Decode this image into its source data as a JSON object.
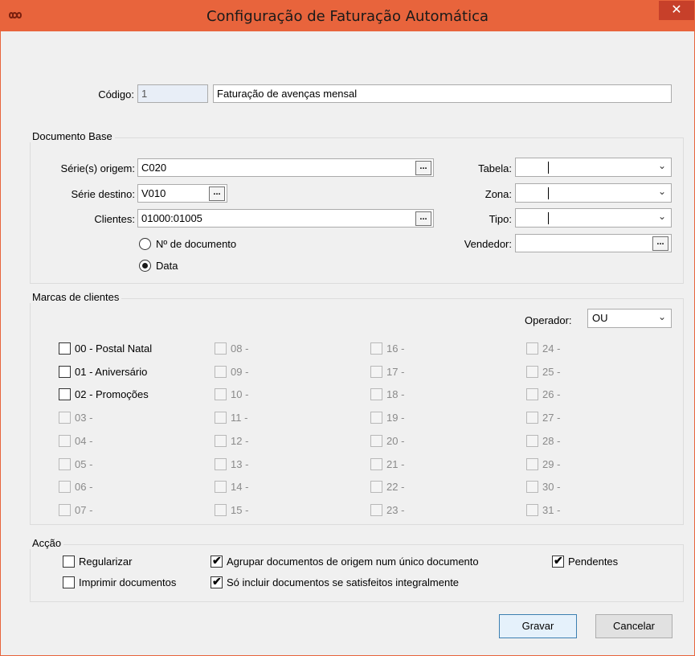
{
  "window": {
    "title": "Configuração de Faturação Automática",
    "close_glyph": "✕",
    "app_icon": "infinity-icon"
  },
  "codigo": {
    "label": "Código:",
    "value": "1",
    "description": "Faturação de avenças mensal"
  },
  "documento_base": {
    "title": "Documento Base",
    "serie_origem_label": "Série(s) origem:",
    "serie_origem_value": "C020",
    "serie_destino_label": "Série destino:",
    "serie_destino_value": "V010",
    "clientes_label": "Clientes:",
    "clientes_value": "01000:01005",
    "ellipsis": "...",
    "radio_num_doc": "Nº de documento",
    "radio_data": "Data",
    "tabela_label": "Tabela:",
    "zona_label": "Zona:",
    "tipo_label": "Tipo:",
    "vendedor_label": "Vendedor:",
    "arrow": "⌄"
  },
  "marcas": {
    "title": "Marcas de clientes",
    "operador_label": "Operador:",
    "operador_value": "OU",
    "columns": [
      [
        "00 - Postal Natal",
        "01 - Aniversário",
        "02 - Promoções",
        "03 -",
        "04 -",
        "05 -",
        "06 -",
        "07 -"
      ],
      [
        "08 -",
        "09 -",
        "10 -",
        "11 -",
        "12 -",
        "13 -",
        "14 -",
        "15 -"
      ],
      [
        "16 -",
        "17 -",
        "18 -",
        "19 -",
        "20 -",
        "21 -",
        "22 -",
        "23 -"
      ],
      [
        "24 -",
        "25 -",
        "26 -",
        "27 -",
        "28 -",
        "29 -",
        "30 -",
        "31 -"
      ]
    ]
  },
  "accao": {
    "title": "Acção",
    "regularizar": "Regularizar",
    "imprimir": "Imprimir documentos",
    "agrupar": "Agrupar documentos de origem num único documento",
    "so_incluir": "Só incluir documentos se satisfeitos integralmente",
    "pendentes": "Pendentes",
    "check_glyph": "✔"
  },
  "buttons": {
    "gravar": "Gravar",
    "cancelar": "Cancelar"
  }
}
